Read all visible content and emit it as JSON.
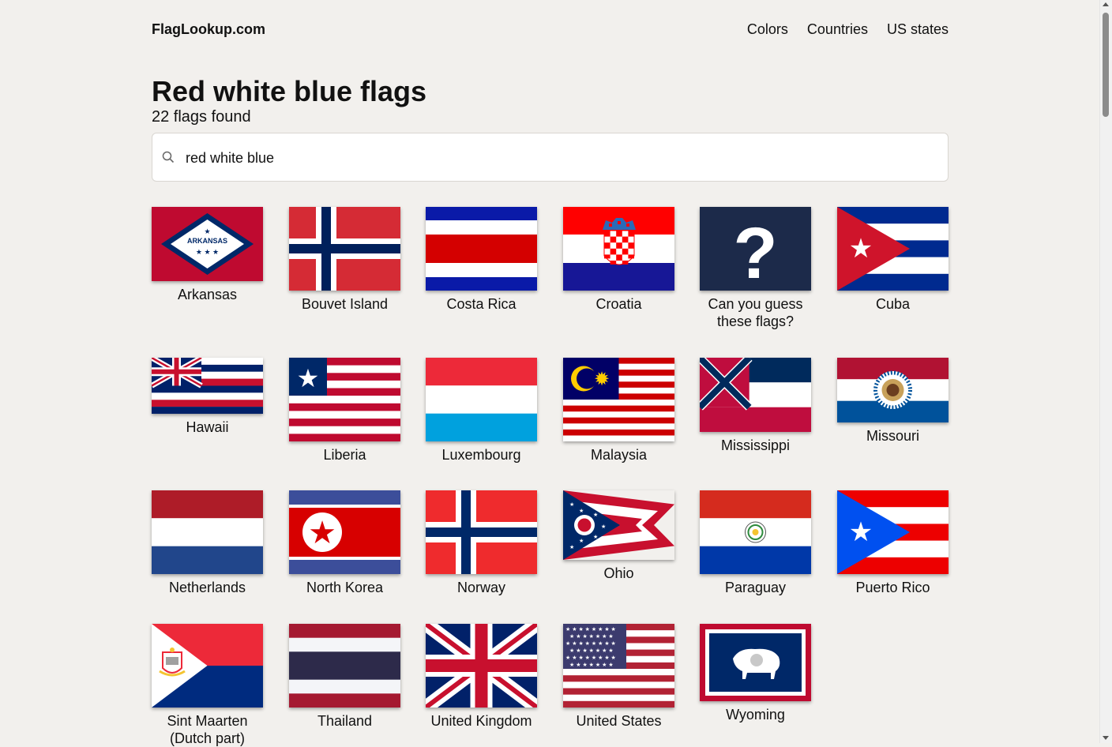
{
  "site": {
    "logo": "FlagLookup.com"
  },
  "nav": [
    "Colors",
    "Countries",
    "US states"
  ],
  "heading": "Red white blue flags",
  "result_count": "22 flags found",
  "search": {
    "value": "red white blue"
  },
  "flags": [
    {
      "name": "Arkansas",
      "label": "Arkansas"
    },
    {
      "name": "Bouvet Island",
      "label": "Bouvet Island"
    },
    {
      "name": "Costa Rica",
      "label": "Costa Rica"
    },
    {
      "name": "Croatia",
      "label": "Croatia"
    },
    {
      "name": "Quiz",
      "label": "Can you guess these flags?"
    },
    {
      "name": "Cuba",
      "label": "Cuba"
    },
    {
      "name": "Hawaii",
      "label": "Hawaii"
    },
    {
      "name": "Liberia",
      "label": "Liberia"
    },
    {
      "name": "Luxembourg",
      "label": "Luxembourg"
    },
    {
      "name": "Malaysia",
      "label": "Malaysia"
    },
    {
      "name": "Mississippi",
      "label": "Mississippi"
    },
    {
      "name": "Missouri",
      "label": "Missouri"
    },
    {
      "name": "Netherlands",
      "label": "Netherlands"
    },
    {
      "name": "North Korea",
      "label": "North Korea"
    },
    {
      "name": "Norway",
      "label": "Norway"
    },
    {
      "name": "Ohio",
      "label": "Ohio"
    },
    {
      "name": "Paraguay",
      "label": "Paraguay"
    },
    {
      "name": "Puerto Rico",
      "label": "Puerto Rico"
    },
    {
      "name": "Sint Maarten",
      "label": "Sint Maarten (Dutch part)"
    },
    {
      "name": "Thailand",
      "label": "Thailand"
    },
    {
      "name": "United Kingdom",
      "label": "United Kingdom"
    },
    {
      "name": "United States",
      "label": "United States"
    },
    {
      "name": "Wyoming",
      "label": "Wyoming"
    }
  ],
  "flag_texts": {
    "arkansas_banner": "ARKANSAS",
    "quiz_glyph": "?"
  }
}
